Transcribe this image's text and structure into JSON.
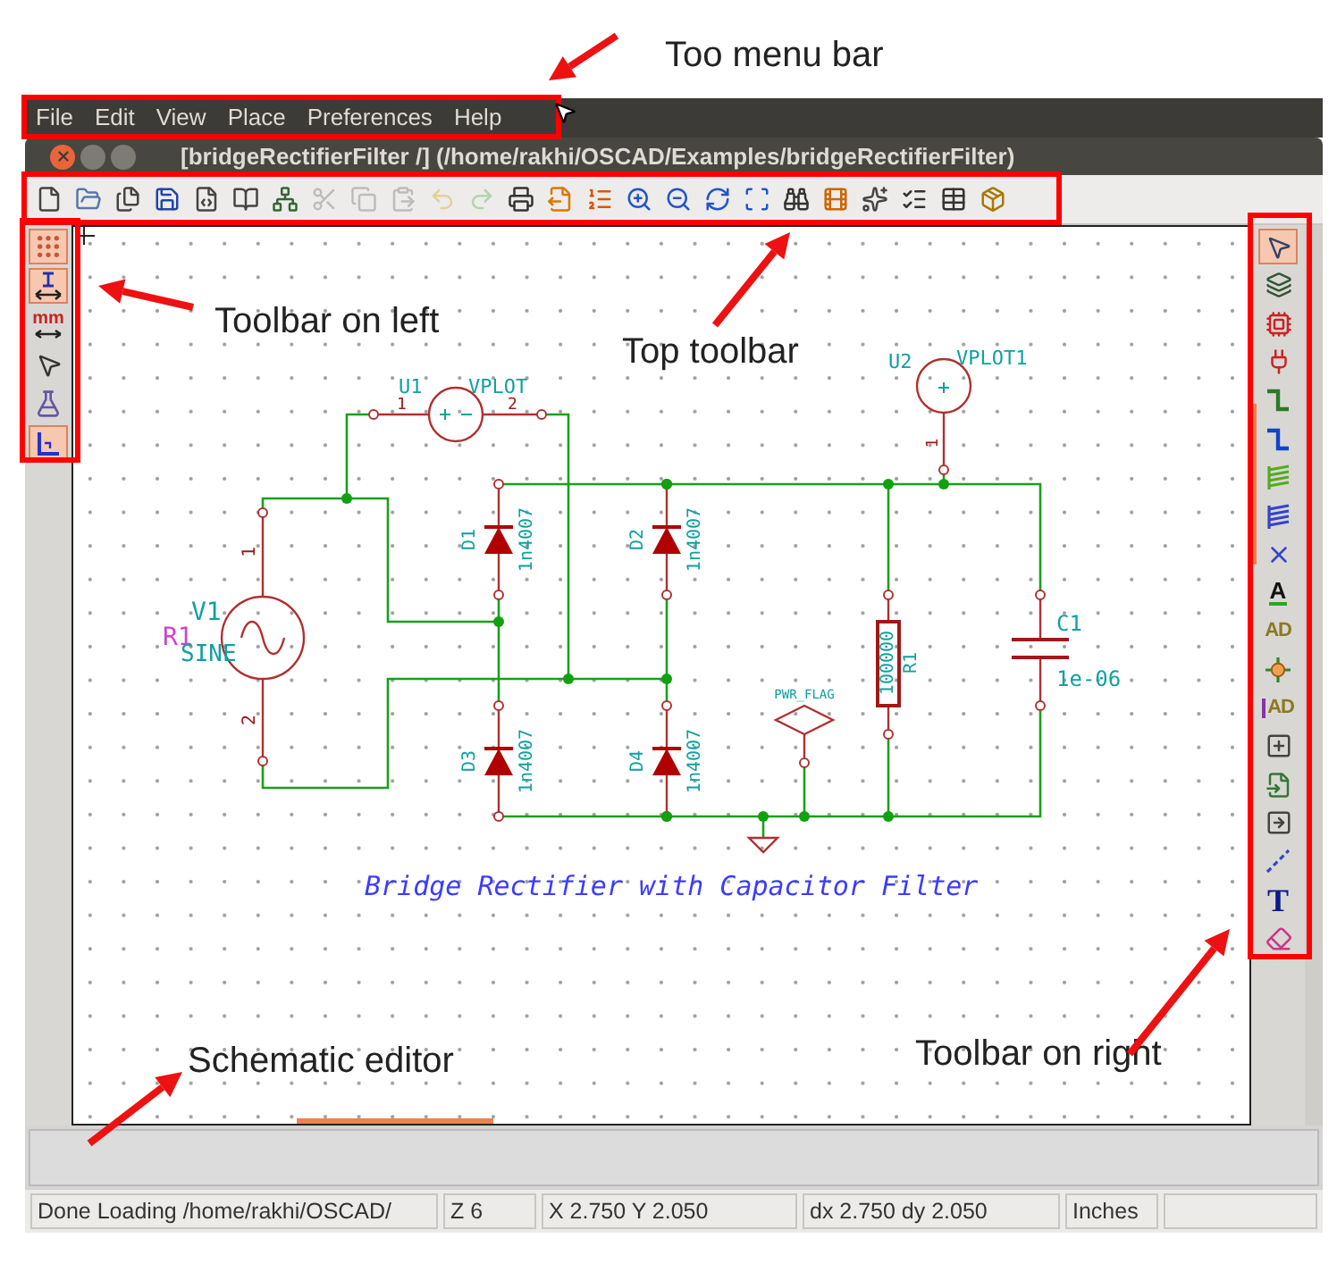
{
  "annotations": [
    "Too menu bar",
    "Toolbar on left",
    "Top toolbar",
    "Schematic editor",
    "Toolbar on right"
  ],
  "menu_bar": {
    "items": [
      "File",
      "Edit",
      "View",
      "Place",
      "Preferences",
      "Help"
    ]
  },
  "window": {
    "title": "[bridgeRectifierFilter /] (/home/rakhi/OSCAD/Examples/bridgeRectifierFilter)"
  },
  "top_toolbar": [
    {
      "disabled": false
    },
    {
      "disabled": false
    },
    {
      "disabled": false
    },
    {
      "disabled": false
    },
    {
      "disabled": false
    },
    {
      "disabled": false
    },
    {
      "disabled": false
    },
    {
      "disabled": true
    },
    {
      "disabled": true
    },
    {
      "disabled": true
    },
    {
      "disabled": true
    },
    {
      "disabled": true
    },
    {
      "disabled": false
    },
    {
      "disabled": false
    },
    {
      "disabled": false
    },
    {
      "disabled": false
    },
    {
      "disabled": false
    },
    {
      "disabled": false
    },
    {
      "disabled": false
    },
    {
      "disabled": false
    },
    {
      "disabled": false
    },
    {
      "disabled": false
    },
    {
      "disabled": false
    },
    {
      "disabled": false
    },
    {
      "disabled": false
    }
  ],
  "left_toolbar": [
    {
      "selected": true
    },
    {
      "selected": true
    },
    {
      "selected": false,
      "glyph": "mm"
    },
    {
      "selected": false
    },
    {
      "selected": false
    },
    {
      "selected": true
    }
  ],
  "right_toolbar": [
    {
      "selected": true
    },
    {
      "selected": false
    },
    {
      "selected": false
    },
    {
      "selected": false
    },
    {
      "selected": false
    },
    {
      "selected": false
    },
    {
      "selected": false
    },
    {
      "selected": false
    },
    {
      "selected": false
    },
    {
      "selected": false,
      "glyph": "A"
    },
    {
      "selected": false,
      "glyph": "AD"
    },
    {
      "selected": false
    },
    {
      "selected": false,
      "glyph": "AD"
    },
    {
      "selected": false
    },
    {
      "selected": false
    },
    {
      "selected": false
    },
    {
      "selected": false
    },
    {
      "selected": false,
      "glyph": "T"
    },
    {
      "selected": false
    }
  ],
  "schematic": {
    "components": [
      {
        "kind": "vplot2",
        "ref": "U1",
        "value": "VPLOT",
        "pins": [
          "1",
          "2"
        ]
      },
      {
        "kind": "vplot1",
        "ref": "U2",
        "value": "VPLOT1",
        "pins": [
          "1"
        ]
      },
      {
        "kind": "source",
        "ref": "V1",
        "value": "SINE",
        "extra_label": "R1",
        "pins": [
          "1",
          "2"
        ]
      },
      {
        "kind": "diode",
        "ref": "D1",
        "value": "1n4007"
      },
      {
        "kind": "diode",
        "ref": "D2",
        "value": "1n4007"
      },
      {
        "kind": "diode",
        "ref": "D3",
        "value": "1n4007"
      },
      {
        "kind": "diode",
        "ref": "D4",
        "value": "1n4007"
      },
      {
        "kind": "pwr_flag",
        "value": "PWR_FLAG"
      },
      {
        "kind": "resistor",
        "ref": "R1",
        "value": "100000"
      },
      {
        "kind": "capacitor",
        "ref": "C1",
        "value": "1e-06"
      }
    ],
    "title_text": "Bridge Rectifier with Capacitor Filter"
  },
  "status_bar": [
    "Done Loading /home/rakhi/OSCAD/",
    "Z 6",
    "X 2.750  Y 2.050",
    "dx 2.750  dy 2.050",
    "Inches"
  ]
}
